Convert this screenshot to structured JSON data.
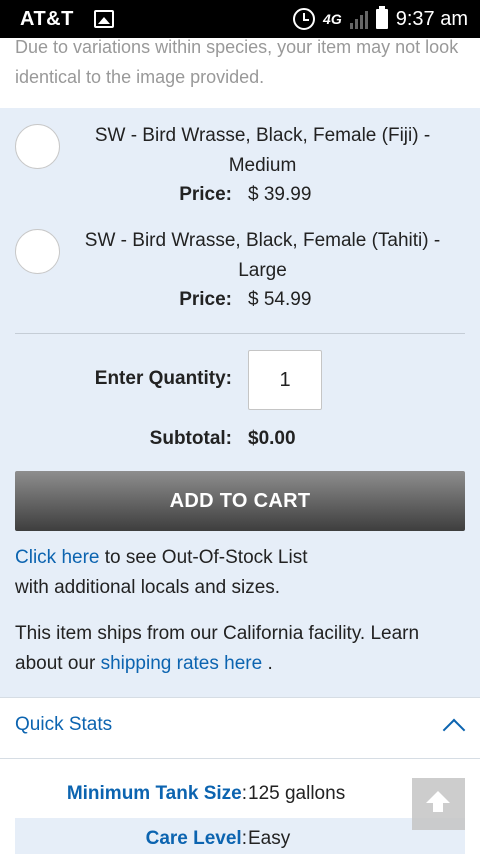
{
  "status_bar": {
    "carrier": "AT&T",
    "network": "4G",
    "time": "9:37 am"
  },
  "disclaimer": "Due to variations within species, your item may not look identical to the image provided.",
  "variants": [
    {
      "name": "SW - Bird Wrasse, Black, Female (Fiji) - Medium",
      "price_label": "Price:",
      "price": "$ 39.99"
    },
    {
      "name": "SW - Bird Wrasse, Black, Female (Tahiti) - Large",
      "price_label": "Price:",
      "price": "$ 54.99"
    }
  ],
  "quantity": {
    "label": "Enter Quantity:",
    "value": "1"
  },
  "subtotal": {
    "label": "Subtotal:",
    "value": "$0.00"
  },
  "add_to_cart_label": "ADD TO CART",
  "out_of_stock": {
    "link_text": "Click here",
    "text_line1": " to see Out-Of-Stock List",
    "text_line2": "with additional locals and sizes."
  },
  "shipping": {
    "text": "This item ships from our California facility. Learn about our ",
    "link_text": "shipping rates here",
    "suffix": " ."
  },
  "quick_stats": {
    "title": "Quick Stats",
    "rows": [
      {
        "label": "Minimum Tank Size",
        "value": "125 gallons"
      },
      {
        "label": "Care Level",
        "value": "Easy"
      }
    ]
  },
  "colors": {
    "link": "#0c64b0",
    "panel_bg": "#e6eef8"
  }
}
